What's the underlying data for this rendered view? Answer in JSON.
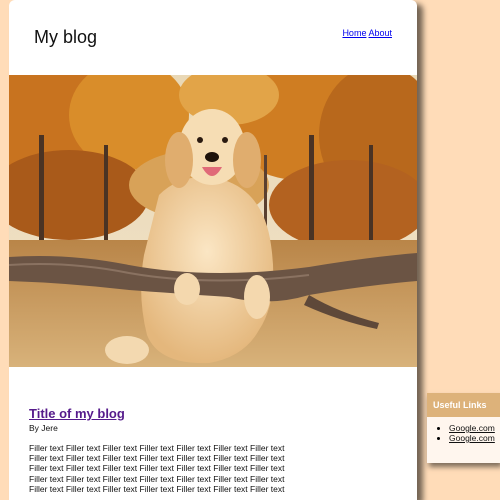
{
  "header": {
    "site_title": "My blog",
    "nav": [
      "Home",
      "About"
    ]
  },
  "post": {
    "title": "Title of my blog",
    "byline": "By Jere",
    "body_lines": [
      "Filler text Filler text Filler text Filler text Filler text Filler text Filler text",
      "Filler text Filler text Filler text Filler text Filler text Filler text Filler text",
      "Filler text Filler text Filler text Filler text Filler text Filler text Filler text",
      "Filler text Filler text Filler text Filler text Filler text Filler text Filler text",
      "Filler text Filler text Filler text Filler text Filler text Filler text Filler text"
    ]
  },
  "sidebar": {
    "heading": "Useful Links",
    "links": [
      "Google.com",
      "Google.com"
    ]
  },
  "colors": {
    "page_background": "#ffdcb8",
    "sidebar_header": "#ddb27a",
    "post_title_link": "#551a8b",
    "nav_link": "#0000ee"
  }
}
